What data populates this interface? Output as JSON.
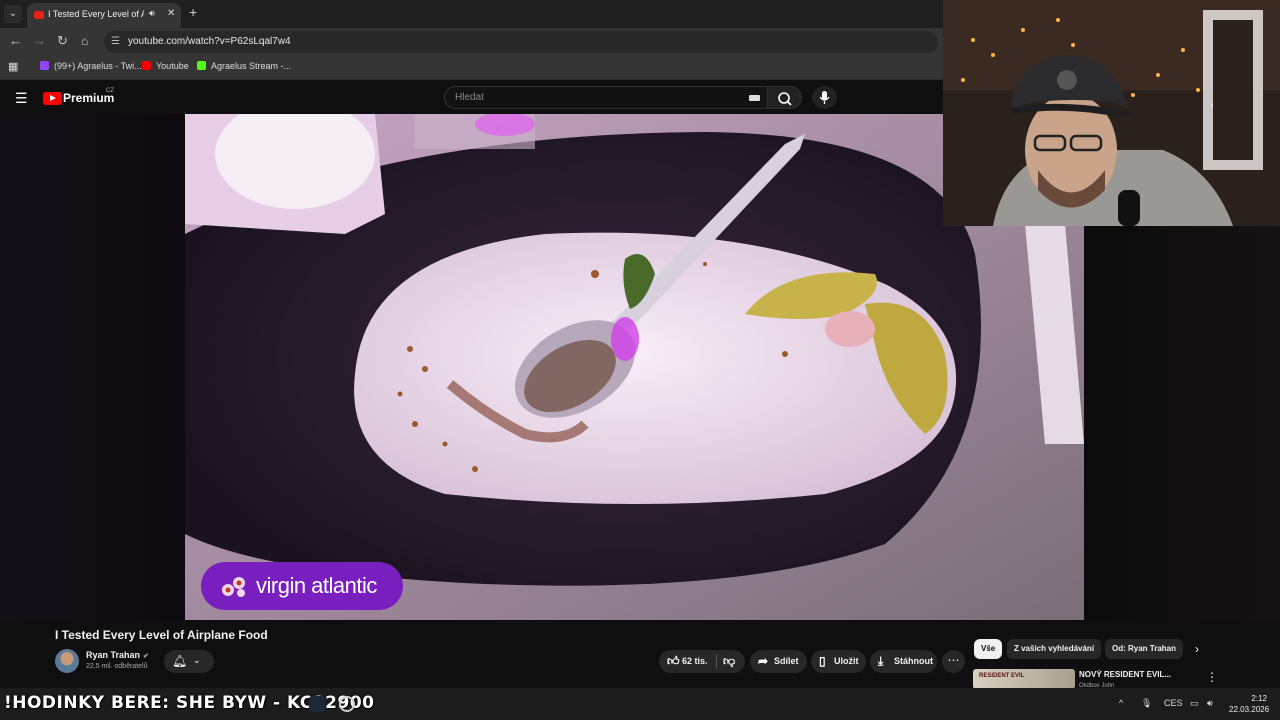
{
  "browser": {
    "tab_title": "I Tested Every Level of Airpl",
    "url": "youtube.com/watch?v=P62sLqal7w4",
    "bookmarks": [
      {
        "label": "(99+) Agraelus - Twi...",
        "color": "#9146ff"
      },
      {
        "label": "Youtube",
        "color": "#ff0000"
      },
      {
        "label": "Agraelus Stream -...",
        "color": "#53fc18"
      }
    ]
  },
  "masthead": {
    "brand": "Premium",
    "region": "CZ",
    "search_placeholder": "Hledat"
  },
  "video": {
    "overlay_brand": "virgin atlantic",
    "brand_color": "#7a1fbf",
    "title": "I Tested Every Level of Airplane Food"
  },
  "channel": {
    "name": "Ryan Trahan",
    "subscribers": "22,5 mil. odběratelů"
  },
  "actions": {
    "likes": "62 tis.",
    "share": "Sdílet",
    "save": "Uložit",
    "download": "Stáhnout"
  },
  "chips": [
    "Vše",
    "Z vašich vyhledávání",
    "Od: Ryan Trahan"
  ],
  "recommendation": {
    "thumb_text": "RESIDENT EVIL",
    "title": "NOVÝ RESIDENT EVIL...",
    "channel": "Okdbov John"
  },
  "stream_overlay": "!HODINKY BERE: SHE  BYW - KC12900",
  "taskbar": {
    "lang": "CES",
    "time": "2:12",
    "date": "22.03.2026"
  }
}
